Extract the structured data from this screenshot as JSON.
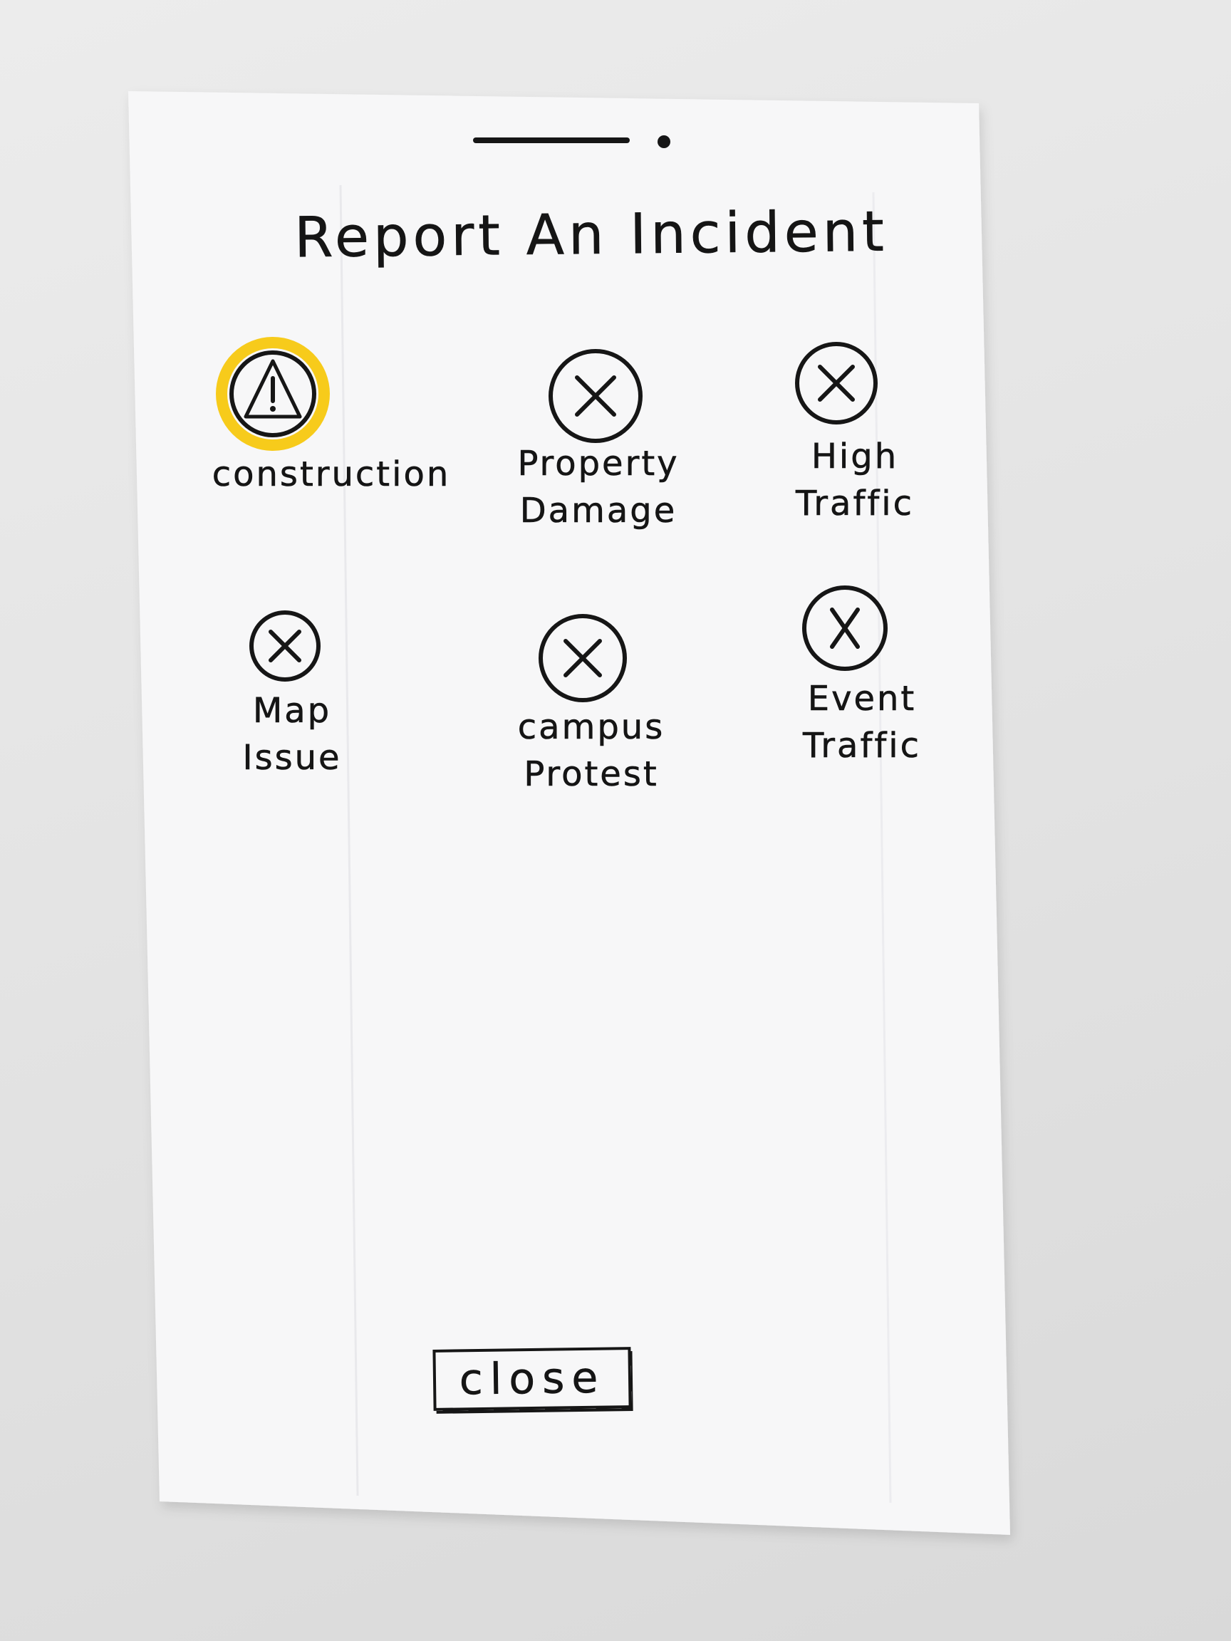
{
  "sheet": {
    "title": "Report An Incident",
    "selected_item": "construction"
  },
  "incidents": [
    {
      "label_lines": [
        "construction"
      ],
      "icon": "warning-triangle-icon",
      "selected": true,
      "highlight_color": "#F7CB1B"
    },
    {
      "label_lines": [
        "Property",
        "Damage"
      ],
      "icon": "x-circle-icon",
      "selected": false
    },
    {
      "label_lines": [
        "High",
        "Traffic"
      ],
      "icon": "x-circle-icon",
      "selected": false
    },
    {
      "label_lines": [
        "Map",
        "Issue"
      ],
      "icon": "x-circle-icon",
      "selected": false
    },
    {
      "label_lines": [
        "campus",
        "Protest"
      ],
      "icon": "x-circle-icon",
      "selected": false
    },
    {
      "label_lines": [
        "Event",
        "Traffic"
      ],
      "icon": "x-circle-icon",
      "selected": false
    }
  ],
  "footer": {
    "close_label": "close"
  },
  "colors": {
    "ink": "#161616",
    "paper": "#F7F7F8",
    "highlight": "#F7CB1B",
    "background": "#E6E6E6"
  }
}
